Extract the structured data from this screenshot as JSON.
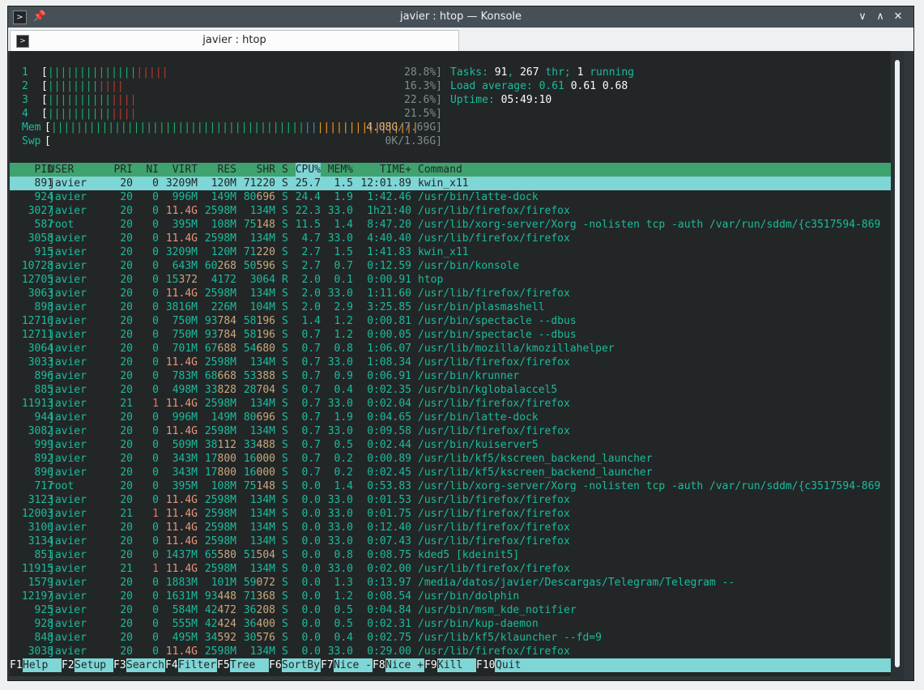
{
  "window": {
    "title": "javier : htop — Konsole",
    "tab_label": "javier : htop",
    "terminal_icon": "terminal-icon"
  },
  "meters": {
    "cpus": [
      {
        "label": "1",
        "value": "28.8%]",
        "green": 14,
        "red": 5
      },
      {
        "label": "2",
        "value": "16.3%]",
        "green": 8,
        "red": 4
      },
      {
        "label": "3",
        "value": "22.6%]",
        "green": 10,
        "red": 4
      },
      {
        "label": "4",
        "value": "21.5%]",
        "green": 10,
        "red": 4
      }
    ],
    "mem": {
      "label": "Mem",
      "value_used": "4.08G",
      "value_total": "/7.69G]"
    },
    "swp": {
      "label": "Swp",
      "value": "0K/1.36G]"
    }
  },
  "stats": {
    "tasks_label": "Tasks: ",
    "tasks": "91",
    "thr_sep": ", ",
    "thr": "267",
    "thr_label": " thr; ",
    "running": "1",
    "running_label": " running",
    "load_label": "Load average: ",
    "load1": "0.61",
    "load5": "0.61",
    "load15": "0.68",
    "uptime_label": "Uptime: ",
    "uptime": "05:49:10"
  },
  "columns": [
    "PID",
    "USER",
    "PRI",
    "NI",
    "VIRT",
    "RES",
    "SHR",
    "S",
    "CPU%",
    "MEM%",
    "TIME+",
    "Command"
  ],
  "processes": [
    {
      "pid": "891",
      "user": "javier",
      "pri": "20",
      "ni": "0",
      "virt": "3209M",
      "res": "120M",
      "shr": "71220",
      "s": "S",
      "cpu": "25.7",
      "mem": "1.5",
      "time": "12:01.89",
      "cmd": "kwin_x11"
    },
    {
      "pid": "924",
      "user": "javier",
      "pri": "20",
      "ni": "0",
      "virt": "996M",
      "res": "149M",
      "shr": "80696",
      "s": "S",
      "cpu": "24.4",
      "mem": "1.9",
      "time": "1:42.46",
      "cmd": "/usr/bin/latte-dock"
    },
    {
      "pid": "3027",
      "user": "javier",
      "pri": "20",
      "ni": "0",
      "virt": "11.4G",
      "res": "2598M",
      "shr": "134M",
      "s": "S",
      "cpu": "22.3",
      "mem": "33.0",
      "time": "1h21:40",
      "cmd": "/usr/lib/firefox/firefox"
    },
    {
      "pid": "587",
      "user": "root",
      "pri": "20",
      "ni": "0",
      "virt": "395M",
      "res": "108M",
      "shr": "75148",
      "s": "S",
      "cpu": "11.5",
      "mem": "1.4",
      "time": "8:47.20",
      "cmd": "/usr/lib/xorg-server/Xorg -nolisten tcp -auth /var/run/sddm/{c3517594-869"
    },
    {
      "pid": "3058",
      "user": "javier",
      "pri": "20",
      "ni": "0",
      "virt": "11.4G",
      "res": "2598M",
      "shr": "134M",
      "s": "S",
      "cpu": "4.7",
      "mem": "33.0",
      "time": "4:40.40",
      "cmd": "/usr/lib/firefox/firefox"
    },
    {
      "pid": "915",
      "user": "javier",
      "pri": "20",
      "ni": "0",
      "virt": "3209M",
      "res": "120M",
      "shr": "71220",
      "s": "S",
      "cpu": "2.7",
      "mem": "1.5",
      "time": "1:41.83",
      "cmd": "kwin_x11"
    },
    {
      "pid": "10728",
      "user": "javier",
      "pri": "20",
      "ni": "0",
      "virt": "643M",
      "res": "60268",
      "shr": "50596",
      "s": "S",
      "cpu": "2.7",
      "mem": "0.7",
      "time": "0:12.59",
      "cmd": "/usr/bin/konsole"
    },
    {
      "pid": "12705",
      "user": "javier",
      "pri": "20",
      "ni": "0",
      "virt": "15372",
      "res": "4172",
      "shr": "3064",
      "s": "R",
      "cpu": "2.0",
      "mem": "0.1",
      "time": "0:00.91",
      "cmd": "htop"
    },
    {
      "pid": "3063",
      "user": "javier",
      "pri": "20",
      "ni": "0",
      "virt": "11.4G",
      "res": "2598M",
      "shr": "134M",
      "s": "S",
      "cpu": "2.0",
      "mem": "33.0",
      "time": "1:11.60",
      "cmd": "/usr/lib/firefox/firefox"
    },
    {
      "pid": "898",
      "user": "javier",
      "pri": "20",
      "ni": "0",
      "virt": "3816M",
      "res": "226M",
      "shr": "104M",
      "s": "S",
      "cpu": "2.0",
      "mem": "2.9",
      "time": "3:25.85",
      "cmd": "/usr/bin/plasmashell"
    },
    {
      "pid": "12710",
      "user": "javier",
      "pri": "20",
      "ni": "0",
      "virt": "750M",
      "res": "93784",
      "shr": "58196",
      "s": "S",
      "cpu": "1.4",
      "mem": "1.2",
      "time": "0:00.81",
      "cmd": "/usr/bin/spectacle --dbus"
    },
    {
      "pid": "12711",
      "user": "javier",
      "pri": "20",
      "ni": "0",
      "virt": "750M",
      "res": "93784",
      "shr": "58196",
      "s": "S",
      "cpu": "0.7",
      "mem": "1.2",
      "time": "0:00.05",
      "cmd": "/usr/bin/spectacle --dbus"
    },
    {
      "pid": "3064",
      "user": "javier",
      "pri": "20",
      "ni": "0",
      "virt": "701M",
      "res": "67688",
      "shr": "54680",
      "s": "S",
      "cpu": "0.7",
      "mem": "0.8",
      "time": "1:06.07",
      "cmd": "/usr/lib/mozilla/kmozillahelper"
    },
    {
      "pid": "3033",
      "user": "javier",
      "pri": "20",
      "ni": "0",
      "virt": "11.4G",
      "res": "2598M",
      "shr": "134M",
      "s": "S",
      "cpu": "0.7",
      "mem": "33.0",
      "time": "1:08.34",
      "cmd": "/usr/lib/firefox/firefox"
    },
    {
      "pid": "896",
      "user": "javier",
      "pri": "20",
      "ni": "0",
      "virt": "783M",
      "res": "68668",
      "shr": "53388",
      "s": "S",
      "cpu": "0.7",
      "mem": "0.9",
      "time": "0:06.91",
      "cmd": "/usr/bin/krunner"
    },
    {
      "pid": "885",
      "user": "javier",
      "pri": "20",
      "ni": "0",
      "virt": "498M",
      "res": "33828",
      "shr": "28704",
      "s": "S",
      "cpu": "0.7",
      "mem": "0.4",
      "time": "0:02.35",
      "cmd": "/usr/bin/kglobalaccel5"
    },
    {
      "pid": "11913",
      "user": "javier",
      "pri": "21",
      "ni": "1",
      "virt": "11.4G",
      "res": "2598M",
      "shr": "134M",
      "s": "S",
      "cpu": "0.7",
      "mem": "33.0",
      "time": "0:02.04",
      "cmd": "/usr/lib/firefox/firefox"
    },
    {
      "pid": "944",
      "user": "javier",
      "pri": "20",
      "ni": "0",
      "virt": "996M",
      "res": "149M",
      "shr": "80696",
      "s": "S",
      "cpu": "0.7",
      "mem": "1.9",
      "time": "0:04.65",
      "cmd": "/usr/bin/latte-dock"
    },
    {
      "pid": "3082",
      "user": "javier",
      "pri": "20",
      "ni": "0",
      "virt": "11.4G",
      "res": "2598M",
      "shr": "134M",
      "s": "S",
      "cpu": "0.7",
      "mem": "33.0",
      "time": "0:09.58",
      "cmd": "/usr/lib/firefox/firefox"
    },
    {
      "pid": "999",
      "user": "javier",
      "pri": "20",
      "ni": "0",
      "virt": "509M",
      "res": "38112",
      "shr": "33488",
      "s": "S",
      "cpu": "0.7",
      "mem": "0.5",
      "time": "0:02.44",
      "cmd": "/usr/bin/kuiserver5"
    },
    {
      "pid": "892",
      "user": "javier",
      "pri": "20",
      "ni": "0",
      "virt": "343M",
      "res": "17800",
      "shr": "16000",
      "s": "S",
      "cpu": "0.7",
      "mem": "0.2",
      "time": "0:00.89",
      "cmd": "/usr/lib/kf5/kscreen_backend_launcher"
    },
    {
      "pid": "890",
      "user": "javier",
      "pri": "20",
      "ni": "0",
      "virt": "343M",
      "res": "17800",
      "shr": "16000",
      "s": "S",
      "cpu": "0.7",
      "mem": "0.2",
      "time": "0:02.45",
      "cmd": "/usr/lib/kf5/kscreen_backend_launcher"
    },
    {
      "pid": "717",
      "user": "root",
      "pri": "20",
      "ni": "0",
      "virt": "395M",
      "res": "108M",
      "shr": "75148",
      "s": "S",
      "cpu": "0.0",
      "mem": "1.4",
      "time": "0:53.83",
      "cmd": "/usr/lib/xorg-server/Xorg -nolisten tcp -auth /var/run/sddm/{c3517594-869"
    },
    {
      "pid": "3123",
      "user": "javier",
      "pri": "20",
      "ni": "0",
      "virt": "11.4G",
      "res": "2598M",
      "shr": "134M",
      "s": "S",
      "cpu": "0.0",
      "mem": "33.0",
      "time": "0:01.53",
      "cmd": "/usr/lib/firefox/firefox"
    },
    {
      "pid": "12003",
      "user": "javier",
      "pri": "21",
      "ni": "1",
      "virt": "11.4G",
      "res": "2598M",
      "shr": "134M",
      "s": "S",
      "cpu": "0.0",
      "mem": "33.0",
      "time": "0:01.75",
      "cmd": "/usr/lib/firefox/firefox"
    },
    {
      "pid": "3100",
      "user": "javier",
      "pri": "20",
      "ni": "0",
      "virt": "11.4G",
      "res": "2598M",
      "shr": "134M",
      "s": "S",
      "cpu": "0.0",
      "mem": "33.0",
      "time": "0:12.40",
      "cmd": "/usr/lib/firefox/firefox"
    },
    {
      "pid": "3134",
      "user": "javier",
      "pri": "20",
      "ni": "0",
      "virt": "11.4G",
      "res": "2598M",
      "shr": "134M",
      "s": "S",
      "cpu": "0.0",
      "mem": "33.0",
      "time": "0:07.43",
      "cmd": "/usr/lib/firefox/firefox"
    },
    {
      "pid": "851",
      "user": "javier",
      "pri": "20",
      "ni": "0",
      "virt": "1437M",
      "res": "65580",
      "shr": "51504",
      "s": "S",
      "cpu": "0.0",
      "mem": "0.8",
      "time": "0:08.75",
      "cmd": "kded5 [kdeinit5]"
    },
    {
      "pid": "11915",
      "user": "javier",
      "pri": "21",
      "ni": "1",
      "virt": "11.4G",
      "res": "2598M",
      "shr": "134M",
      "s": "S",
      "cpu": "0.0",
      "mem": "33.0",
      "time": "0:02.00",
      "cmd": "/usr/lib/firefox/firefox"
    },
    {
      "pid": "1579",
      "user": "javier",
      "pri": "20",
      "ni": "0",
      "virt": "1883M",
      "res": "101M",
      "shr": "59072",
      "s": "S",
      "cpu": "0.0",
      "mem": "1.3",
      "time": "0:13.97",
      "cmd": "/media/datos/javier/Descargas/Telegram/Telegram --"
    },
    {
      "pid": "12197",
      "user": "javier",
      "pri": "20",
      "ni": "0",
      "virt": "1631M",
      "res": "93448",
      "shr": "71368",
      "s": "S",
      "cpu": "0.0",
      "mem": "1.2",
      "time": "0:08.54",
      "cmd": "/usr/bin/dolphin"
    },
    {
      "pid": "925",
      "user": "javier",
      "pri": "20",
      "ni": "0",
      "virt": "584M",
      "res": "42472",
      "shr": "36208",
      "s": "S",
      "cpu": "0.0",
      "mem": "0.5",
      "time": "0:04.84",
      "cmd": "/usr/bin/msm_kde_notifier"
    },
    {
      "pid": "928",
      "user": "javier",
      "pri": "20",
      "ni": "0",
      "virt": "555M",
      "res": "42424",
      "shr": "36400",
      "s": "S",
      "cpu": "0.0",
      "mem": "0.5",
      "time": "0:02.31",
      "cmd": "/usr/bin/kup-daemon"
    },
    {
      "pid": "848",
      "user": "javier",
      "pri": "20",
      "ni": "0",
      "virt": "495M",
      "res": "34592",
      "shr": "30576",
      "s": "S",
      "cpu": "0.0",
      "mem": "0.4",
      "time": "0:02.75",
      "cmd": "/usr/lib/kf5/klauncher --fd=9"
    },
    {
      "pid": "3038",
      "user": "javier",
      "pri": "20",
      "ni": "0",
      "virt": "11.4G",
      "res": "2598M",
      "shr": "134M",
      "s": "S",
      "cpu": "0.0",
      "mem": "33.0",
      "time": "0:29.00",
      "cmd": "/usr/lib/firefox/firefox"
    }
  ],
  "footer": [
    {
      "key": "F1",
      "label": "Help  "
    },
    {
      "key": "F2",
      "label": "Setup "
    },
    {
      "key": "F3",
      "label": "Search"
    },
    {
      "key": "F4",
      "label": "Filter"
    },
    {
      "key": "F5",
      "label": "Tree  "
    },
    {
      "key": "F6",
      "label": "SortBy"
    },
    {
      "key": "F7",
      "label": "Nice -"
    },
    {
      "key": "F8",
      "label": "Nice +"
    },
    {
      "key": "F9",
      "label": "Kill  "
    },
    {
      "key": "F10",
      "label": "Quit"
    }
  ]
}
